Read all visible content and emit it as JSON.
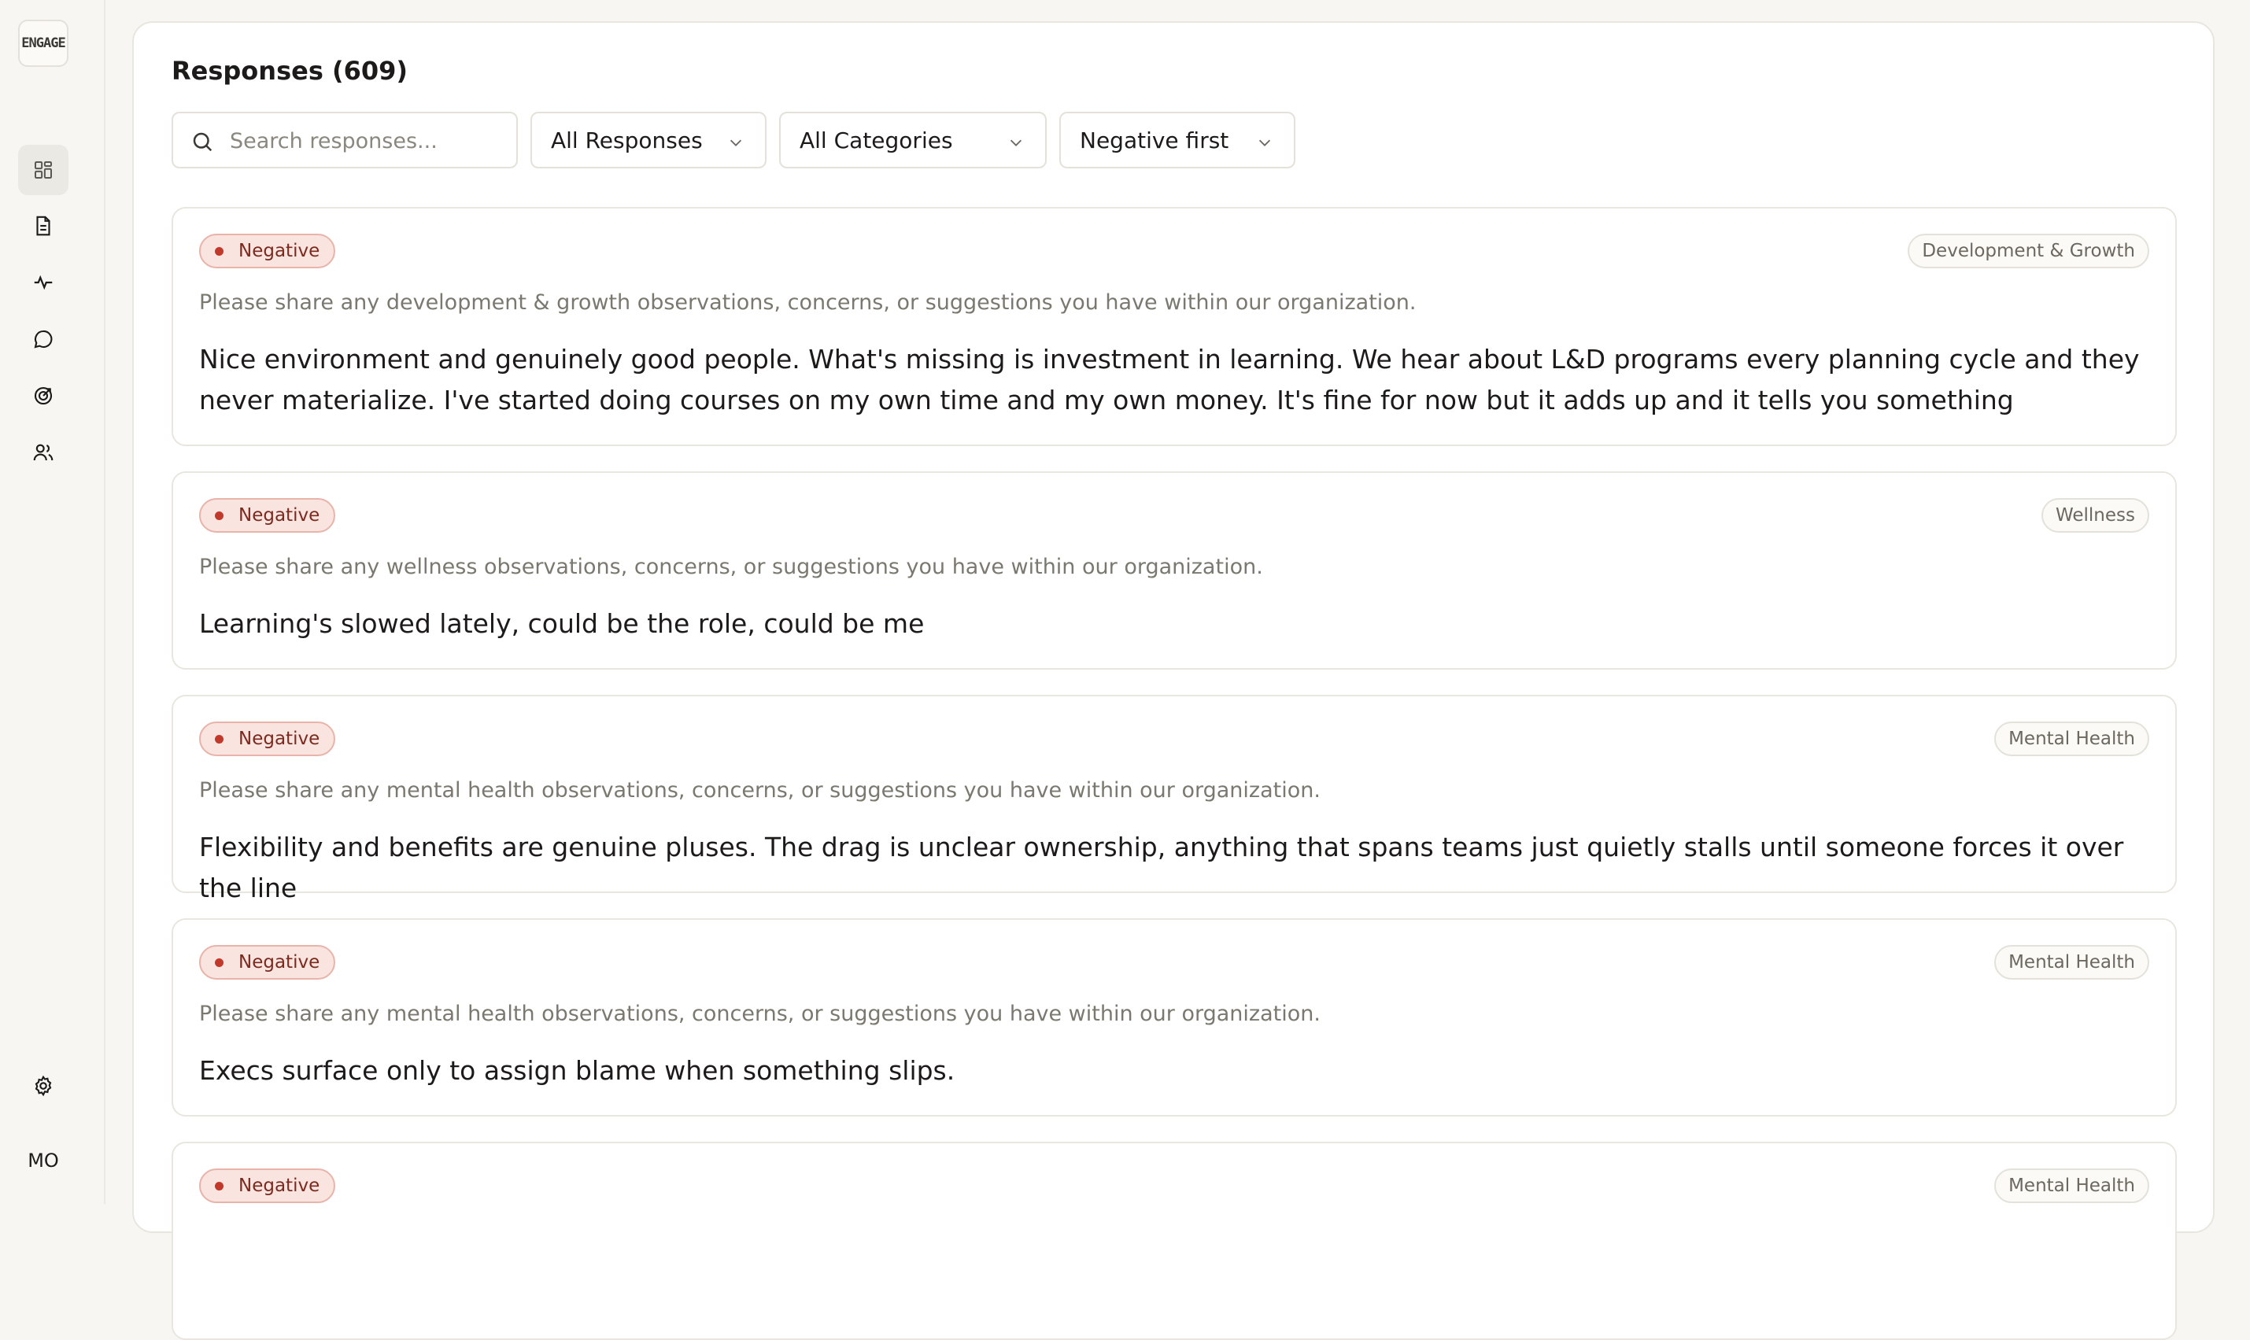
{
  "sidebar": {
    "logo_text": "ENGAGE",
    "items": [
      {
        "icon": "dashboard-icon",
        "active": true
      },
      {
        "icon": "document-icon",
        "active": false
      },
      {
        "icon": "pulse-icon",
        "active": false
      },
      {
        "icon": "chat-icon",
        "active": false
      },
      {
        "icon": "target-icon",
        "active": false
      },
      {
        "icon": "people-icon",
        "active": false
      }
    ],
    "settings_icon": "gear-icon",
    "user_initials": "MO"
  },
  "header": {
    "title": "Responses (609)"
  },
  "filters": {
    "search_placeholder": "Search responses...",
    "response_filter": "All Responses",
    "category_filter": "All Categories",
    "sort": "Negative first"
  },
  "responses": [
    {
      "sentiment": "Negative",
      "category": "Development & Growth",
      "question": "Please share any development & growth observations, concerns, or suggestions you have within our organization.",
      "answer": "Nice environment and genuinely good people. What's missing is investment in learning. We hear about L&D programs every planning cycle and they never materialize. I've started doing courses on my own time and my own money. It's fine for now but it adds up and it tells you something"
    },
    {
      "sentiment": "Negative",
      "category": "Wellness",
      "question": "Please share any wellness observations, concerns, or suggestions you have within our organization.",
      "answer": "Learning's slowed lately, could be the role, could be me"
    },
    {
      "sentiment": "Negative",
      "category": "Mental Health",
      "question": "Please share any mental health observations, concerns, or suggestions you have within our organization.",
      "answer": "Flexibility and benefits are genuine pluses. The drag is unclear ownership, anything that spans teams just quietly stalls until someone forces it over the line"
    },
    {
      "sentiment": "Negative",
      "category": "Mental Health",
      "question": "Please share any mental health observations, concerns, or suggestions you have within our organization.",
      "answer": "Execs surface only to assign blame when something slips."
    },
    {
      "sentiment": "Negative",
      "category": "Mental Health",
      "question": "",
      "answer": ""
    }
  ],
  "colors": {
    "negative_badge_bg": "#fae4df",
    "negative_dot": "#c0392b",
    "page_bg": "#f7f6f2"
  }
}
